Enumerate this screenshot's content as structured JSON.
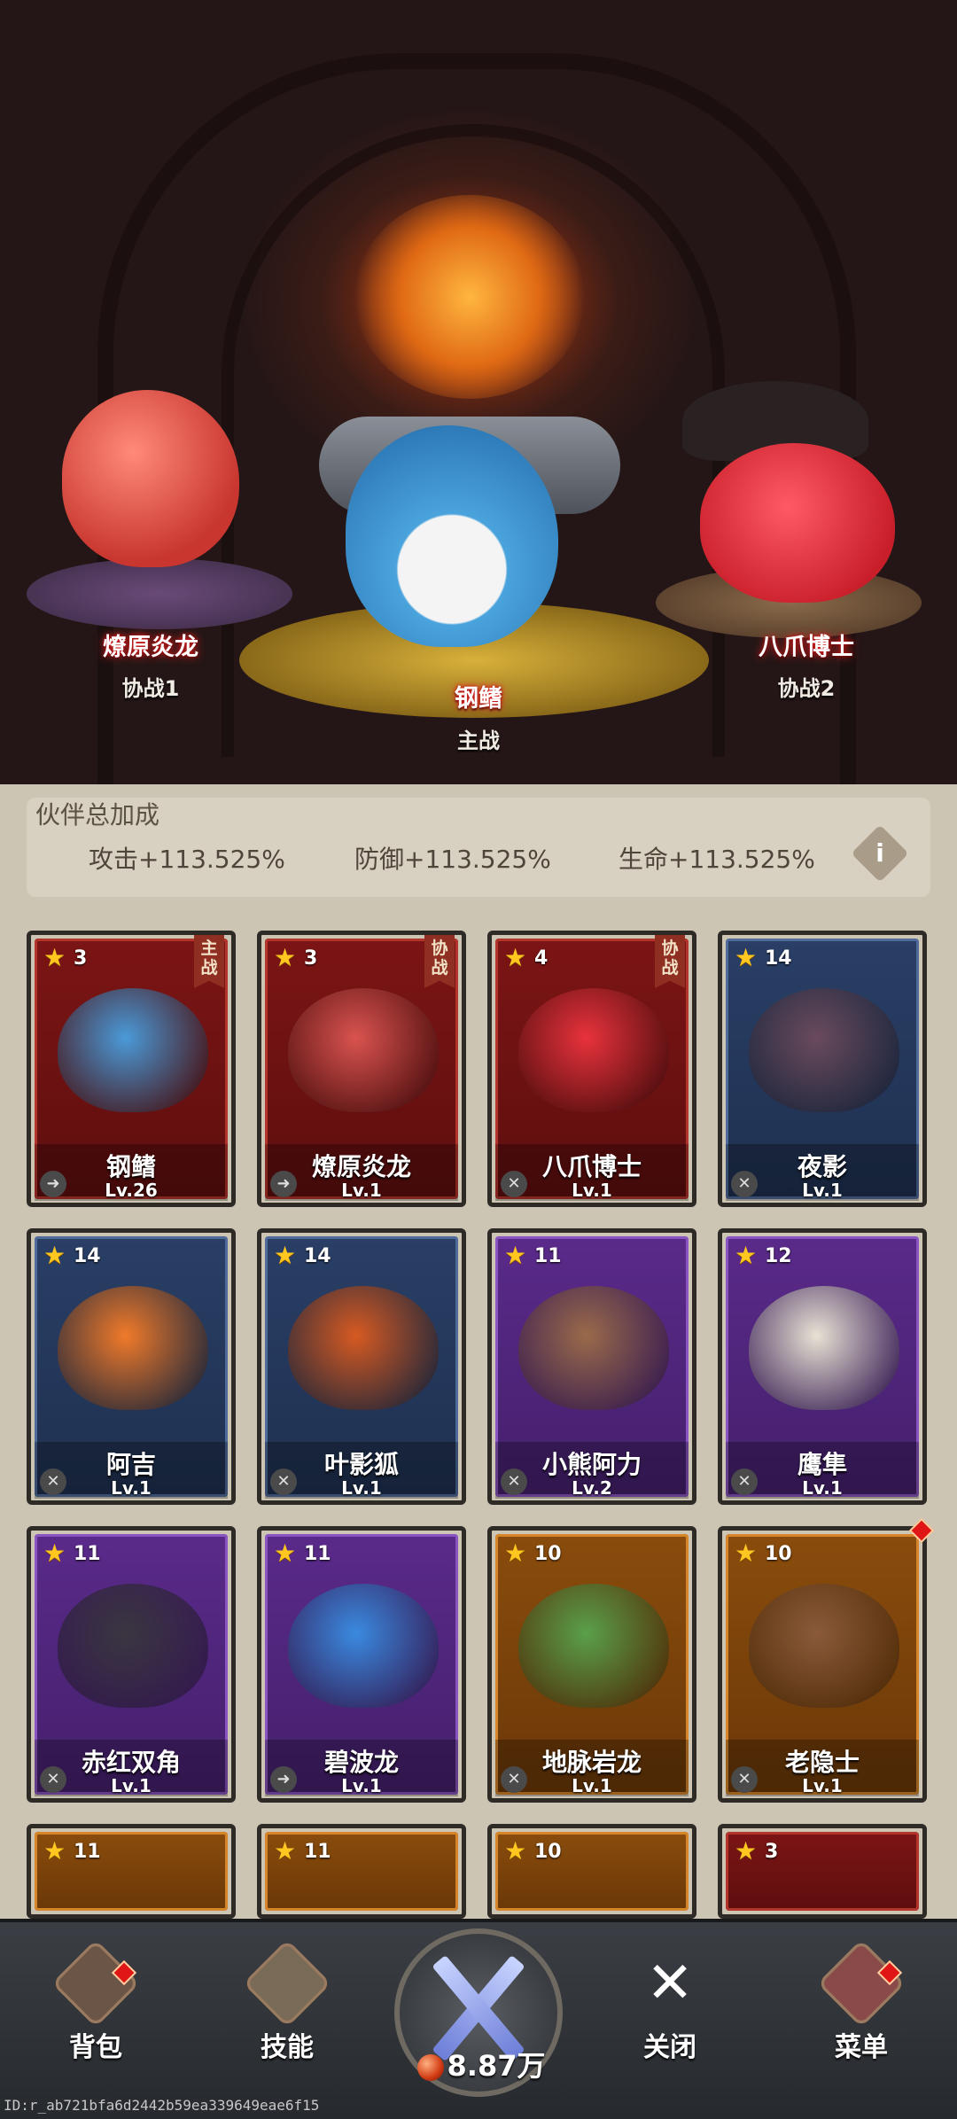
{
  "lineup": {
    "left": {
      "name": "燎原炎龙",
      "role": "协战1"
    },
    "center": {
      "name": "钢鳍",
      "role": "主战"
    },
    "right": {
      "name": "八爪博士",
      "role": "协战2"
    }
  },
  "bonus": {
    "title": "伙伴总加成",
    "attack": "攻击+113.525%",
    "defense": "防御+113.525%",
    "hp": "生命+113.525%",
    "info_icon": "i"
  },
  "cards": [
    {
      "name": "钢鳍",
      "level": "Lv.26",
      "stars": "3",
      "rarity": "red",
      "badge": "主战",
      "color": "#4a9ad8"
    },
    {
      "name": "燎原炎龙",
      "level": "Lv.1",
      "stars": "3",
      "rarity": "red",
      "badge": "协战",
      "color": "#d9534f"
    },
    {
      "name": "八爪博士",
      "level": "Lv.1",
      "stars": "4",
      "rarity": "red",
      "badge": "协战",
      "color": "#e8323c"
    },
    {
      "name": "夜影",
      "level": "Lv.1",
      "stars": "14",
      "rarity": "blue",
      "badge": "",
      "color": "#6a4a5c"
    },
    {
      "name": "阿吉",
      "level": "Lv.1",
      "stars": "14",
      "rarity": "blue",
      "badge": "",
      "color": "#f07a2a"
    },
    {
      "name": "叶影狐",
      "level": "Lv.1",
      "stars": "14",
      "rarity": "blue",
      "badge": "",
      "color": "#d65a22"
    },
    {
      "name": "小熊阿力",
      "level": "Lv.2",
      "stars": "11",
      "rarity": "purple",
      "badge": "",
      "color": "#9a6a4a"
    },
    {
      "name": "鹰隼",
      "level": "Lv.1",
      "stars": "12",
      "rarity": "purple",
      "badge": "",
      "color": "#e8e2d4"
    },
    {
      "name": "赤红双角",
      "level": "Lv.1",
      "stars": "11",
      "rarity": "purple",
      "badge": "",
      "color": "#3a3640"
    },
    {
      "name": "碧波龙",
      "level": "Lv.1",
      "stars": "11",
      "rarity": "purple",
      "badge": "",
      "color": "#3a8ae0"
    },
    {
      "name": "地脉岩龙",
      "level": "Lv.1",
      "stars": "10",
      "rarity": "orange",
      "badge": "",
      "color": "#5aa04a"
    },
    {
      "name": "老隐士",
      "level": "Lv.1",
      "stars": "10",
      "rarity": "orange",
      "badge": "",
      "color": "#8a5a3a"
    }
  ],
  "partial_cards": [
    {
      "stars": "11",
      "rarity": "orange"
    },
    {
      "stars": "11",
      "rarity": "orange"
    },
    {
      "stars": "10",
      "rarity": "orange"
    },
    {
      "stars": "3",
      "rarity": "red"
    }
  ],
  "nav": {
    "bag": "背包",
    "skills": "技能",
    "power": "8.87万",
    "close": "关闭",
    "menu": "菜单"
  },
  "footer_id": "ID:r_ab721bfa6d2442b59ea339649eae6f15"
}
